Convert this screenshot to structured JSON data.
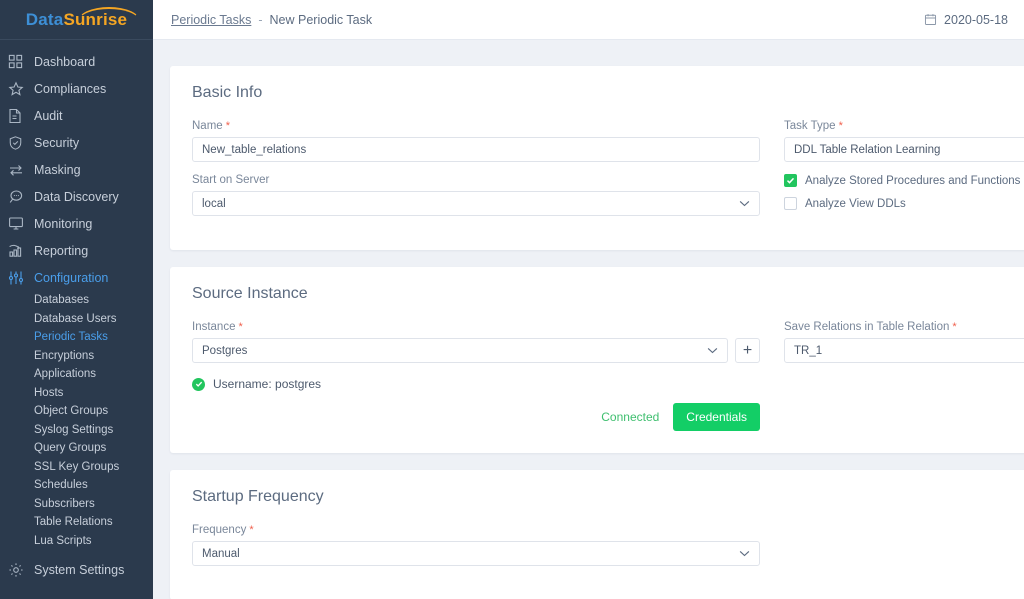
{
  "brand": {
    "part1": "Data",
    "part2": "Sunrise"
  },
  "sidebar": {
    "items": [
      {
        "label": "Dashboard",
        "icon": "grid-icon",
        "active": false
      },
      {
        "label": "Compliances",
        "icon": "star-icon",
        "active": false
      },
      {
        "label": "Audit",
        "icon": "document-icon",
        "active": false
      },
      {
        "label": "Security",
        "icon": "shield-check-icon",
        "active": false
      },
      {
        "label": "Masking",
        "icon": "swap-arrows-icon",
        "active": false
      },
      {
        "label": "Data Discovery",
        "icon": "search-bubble-icon",
        "active": false
      },
      {
        "label": "Monitoring",
        "icon": "monitor-icon",
        "active": false
      },
      {
        "label": "Reporting",
        "icon": "bar-chart-icon",
        "active": false
      },
      {
        "label": "Configuration",
        "icon": "sliders-icon",
        "active": true
      }
    ],
    "sub_items": [
      {
        "label": "Databases",
        "active": false
      },
      {
        "label": "Database Users",
        "active": false
      },
      {
        "label": "Periodic Tasks",
        "active": true
      },
      {
        "label": "Encryptions",
        "active": false
      },
      {
        "label": "Applications",
        "active": false
      },
      {
        "label": "Hosts",
        "active": false
      },
      {
        "label": "Object Groups",
        "active": false
      },
      {
        "label": "Syslog Settings",
        "active": false
      },
      {
        "label": "Query Groups",
        "active": false
      },
      {
        "label": "SSL Key Groups",
        "active": false
      },
      {
        "label": "Schedules",
        "active": false
      },
      {
        "label": "Subscribers",
        "active": false
      },
      {
        "label": "Table Relations",
        "active": false
      },
      {
        "label": "Lua Scripts",
        "active": false
      }
    ],
    "system_settings": {
      "label": "System Settings",
      "icon": "gear-icon"
    }
  },
  "topbar": {
    "breadcrumb_link": "Periodic Tasks",
    "breadcrumb_sep": "-",
    "breadcrumb_current": "New Periodic Task",
    "date": "2020-05-18",
    "date_icon": "calendar-icon"
  },
  "basic_info": {
    "title": "Basic Info",
    "name_label": "Name",
    "name_value": "New_table_relations",
    "start_on_server_label": "Start on Server",
    "start_on_server_value": "local",
    "task_type_label": "Task Type",
    "task_type_value": "DDL Table Relation Learning",
    "checkbox_stored_procs": "Analyze Stored Procedures and Functions DDLs",
    "checkbox_stored_procs_checked": true,
    "checkbox_view_ddls": "Analyze View DDLs",
    "checkbox_view_ddls_checked": false
  },
  "source_instance": {
    "title": "Source Instance",
    "instance_label": "Instance",
    "instance_value": "Postgres",
    "add_instance_label": "+",
    "save_relations_label": "Save Relations in Table Relation",
    "save_relations_value": "TR_1",
    "username_status": "Username: postgres",
    "connected_label": "Connected",
    "credentials_button": "Credentials"
  },
  "startup_frequency": {
    "title": "Startup Frequency",
    "frequency_label": "Frequency",
    "frequency_value": "Manual"
  },
  "colors": {
    "sidebar_bg": "#2b3a4d",
    "accent_blue": "#4a9eea",
    "green": "#13ce66",
    "required_red": "#f0604d",
    "logo_blue": "#3d8fd6",
    "logo_orange": "#f5a623"
  }
}
